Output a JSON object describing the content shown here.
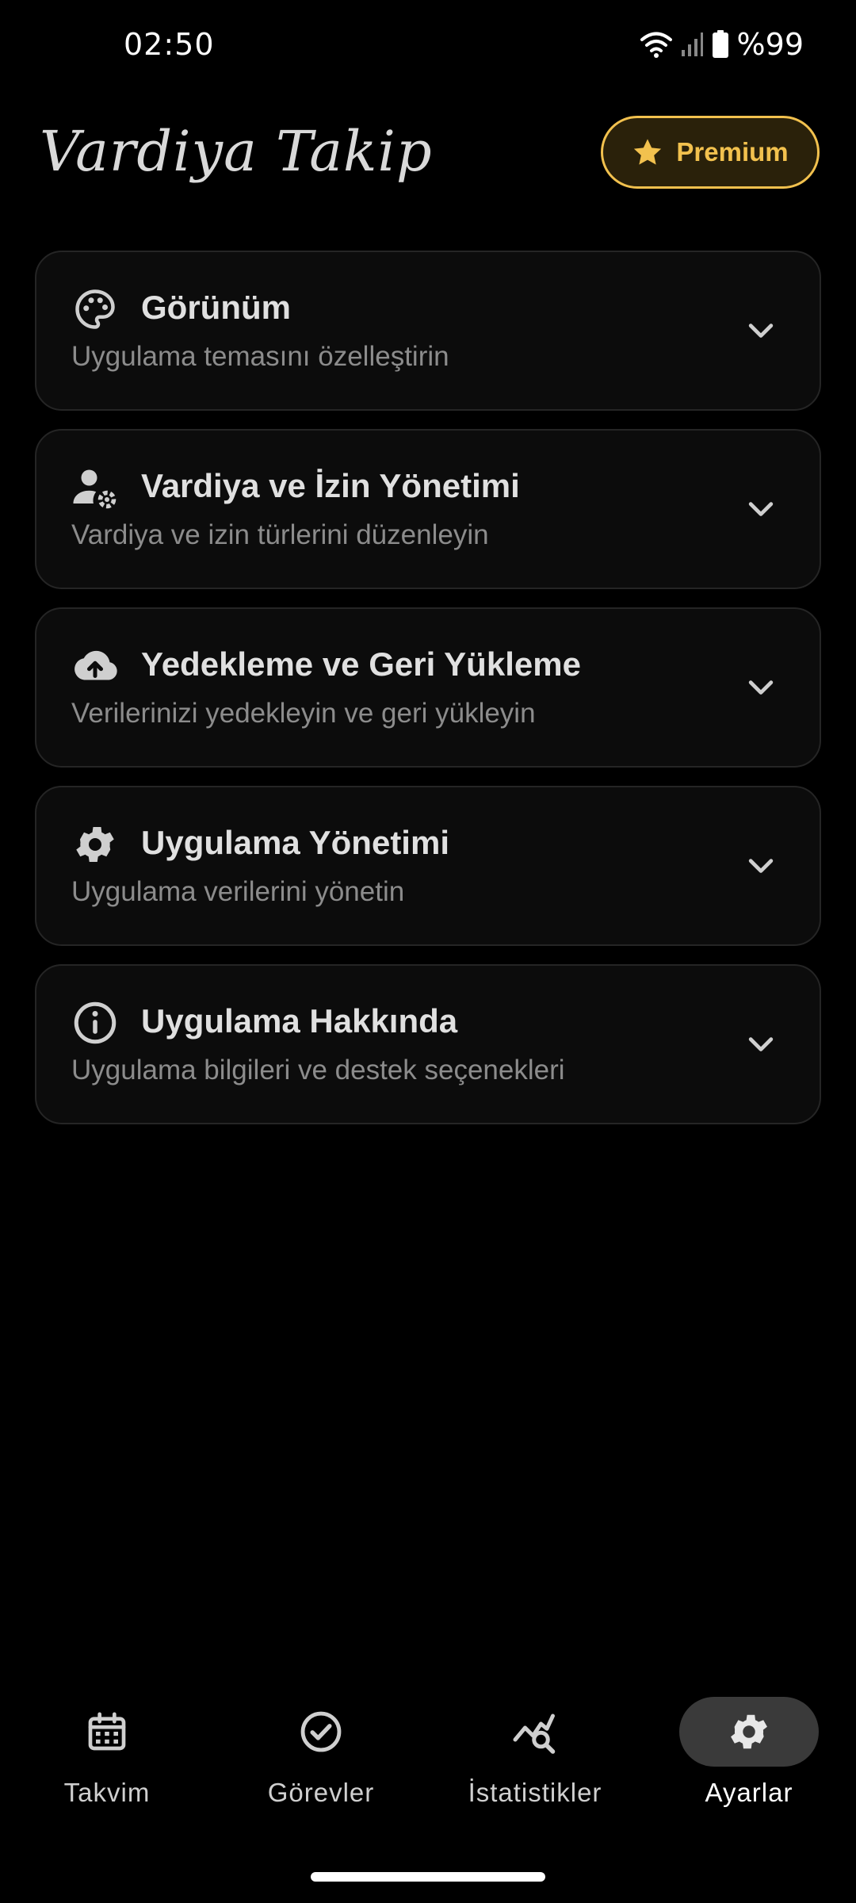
{
  "status_bar": {
    "time": "02:50",
    "battery": "%99"
  },
  "header": {
    "title": "Vardiya Takip",
    "premium_label": "Premium"
  },
  "settings": [
    {
      "icon": "palette-icon",
      "title": "Görünüm",
      "subtitle": "Uygulama temasını özelleştirin"
    },
    {
      "icon": "user-settings-icon",
      "title": "Vardiya ve İzin Yönetimi",
      "subtitle": "Vardiya ve izin türlerini düzenleyin"
    },
    {
      "icon": "cloud-upload-icon",
      "title": "Yedekleme ve Geri Yükleme",
      "subtitle": "Verilerinizi yedekleyin ve geri yükleyin"
    },
    {
      "icon": "gear-icon",
      "title": "Uygulama Yönetimi",
      "subtitle": "Uygulama verilerini yönetin"
    },
    {
      "icon": "info-icon",
      "title": "Uygulama Hakkında",
      "subtitle": "Uygulama bilgileri ve destek seçenekleri"
    }
  ],
  "nav": [
    {
      "label": "Takvim",
      "icon": "calendar-icon",
      "active": false
    },
    {
      "label": "Görevler",
      "icon": "check-circle-icon",
      "active": false
    },
    {
      "label": "İstatistikler",
      "icon": "stats-search-icon",
      "active": false
    },
    {
      "label": "Ayarlar",
      "icon": "gear-icon",
      "active": true
    }
  ],
  "colors": {
    "accent": "#f2c14e",
    "background": "#000000",
    "card": "#0c0c0c"
  }
}
